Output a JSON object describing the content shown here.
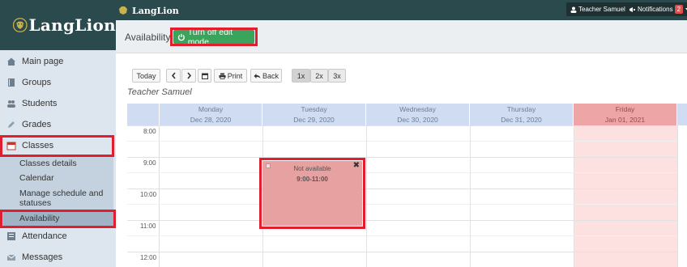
{
  "app": {
    "brand": "LangLion",
    "brand_small": "LangLion"
  },
  "topbar": {
    "user": "Teacher Samuel",
    "notifications_label": "Notifications",
    "notifications_count": "2"
  },
  "sidebar": {
    "items": [
      {
        "label": "Main page",
        "icon": "home-icon"
      },
      {
        "label": "Groups",
        "icon": "book-icon"
      },
      {
        "label": "Students",
        "icon": "users-icon"
      },
      {
        "label": "Grades",
        "icon": "pencil-icon"
      },
      {
        "label": "Classes",
        "icon": "calendar-icon"
      },
      {
        "label": "Attendance",
        "icon": "checklist-icon"
      },
      {
        "label": "Messages",
        "icon": "envelope-icon"
      }
    ],
    "subitems": [
      {
        "label": "Classes details"
      },
      {
        "label": "Calendar"
      },
      {
        "label": "Manage schedule and statuses"
      },
      {
        "label": "Availability"
      }
    ]
  },
  "header": {
    "title": "Availability",
    "edit_button": "Turn off edit mode"
  },
  "toolbar": {
    "today": "Today",
    "prev": "<",
    "next": ">",
    "print": "Print",
    "back": "Back",
    "zoom": [
      "1x",
      "2x",
      "3x"
    ],
    "zoom_selected": "1x"
  },
  "calendar": {
    "teacher": "Teacher Samuel",
    "days": [
      {
        "name": "Monday",
        "date": "Dec 28, 2020"
      },
      {
        "name": "Tuesday",
        "date": "Dec 29, 2020"
      },
      {
        "name": "Wednesday",
        "date": "Dec 30, 2020"
      },
      {
        "name": "Thursday",
        "date": "Dec 31, 2020"
      },
      {
        "name": "Friday",
        "date": "Jan 01, 2021"
      }
    ],
    "times": [
      "8:00",
      "9:00",
      "10:00",
      "11:00",
      "12:00"
    ],
    "event": {
      "title": "Not available",
      "time": "9:00-11:00"
    }
  },
  "colors": {
    "highlight": "#e01e2d",
    "edit_button": "#3aa35c",
    "header_bar": "#2b4a4e",
    "day_header": "#cfdcf2",
    "holiday": "#eda5a5",
    "event": "#e8a1a1"
  }
}
